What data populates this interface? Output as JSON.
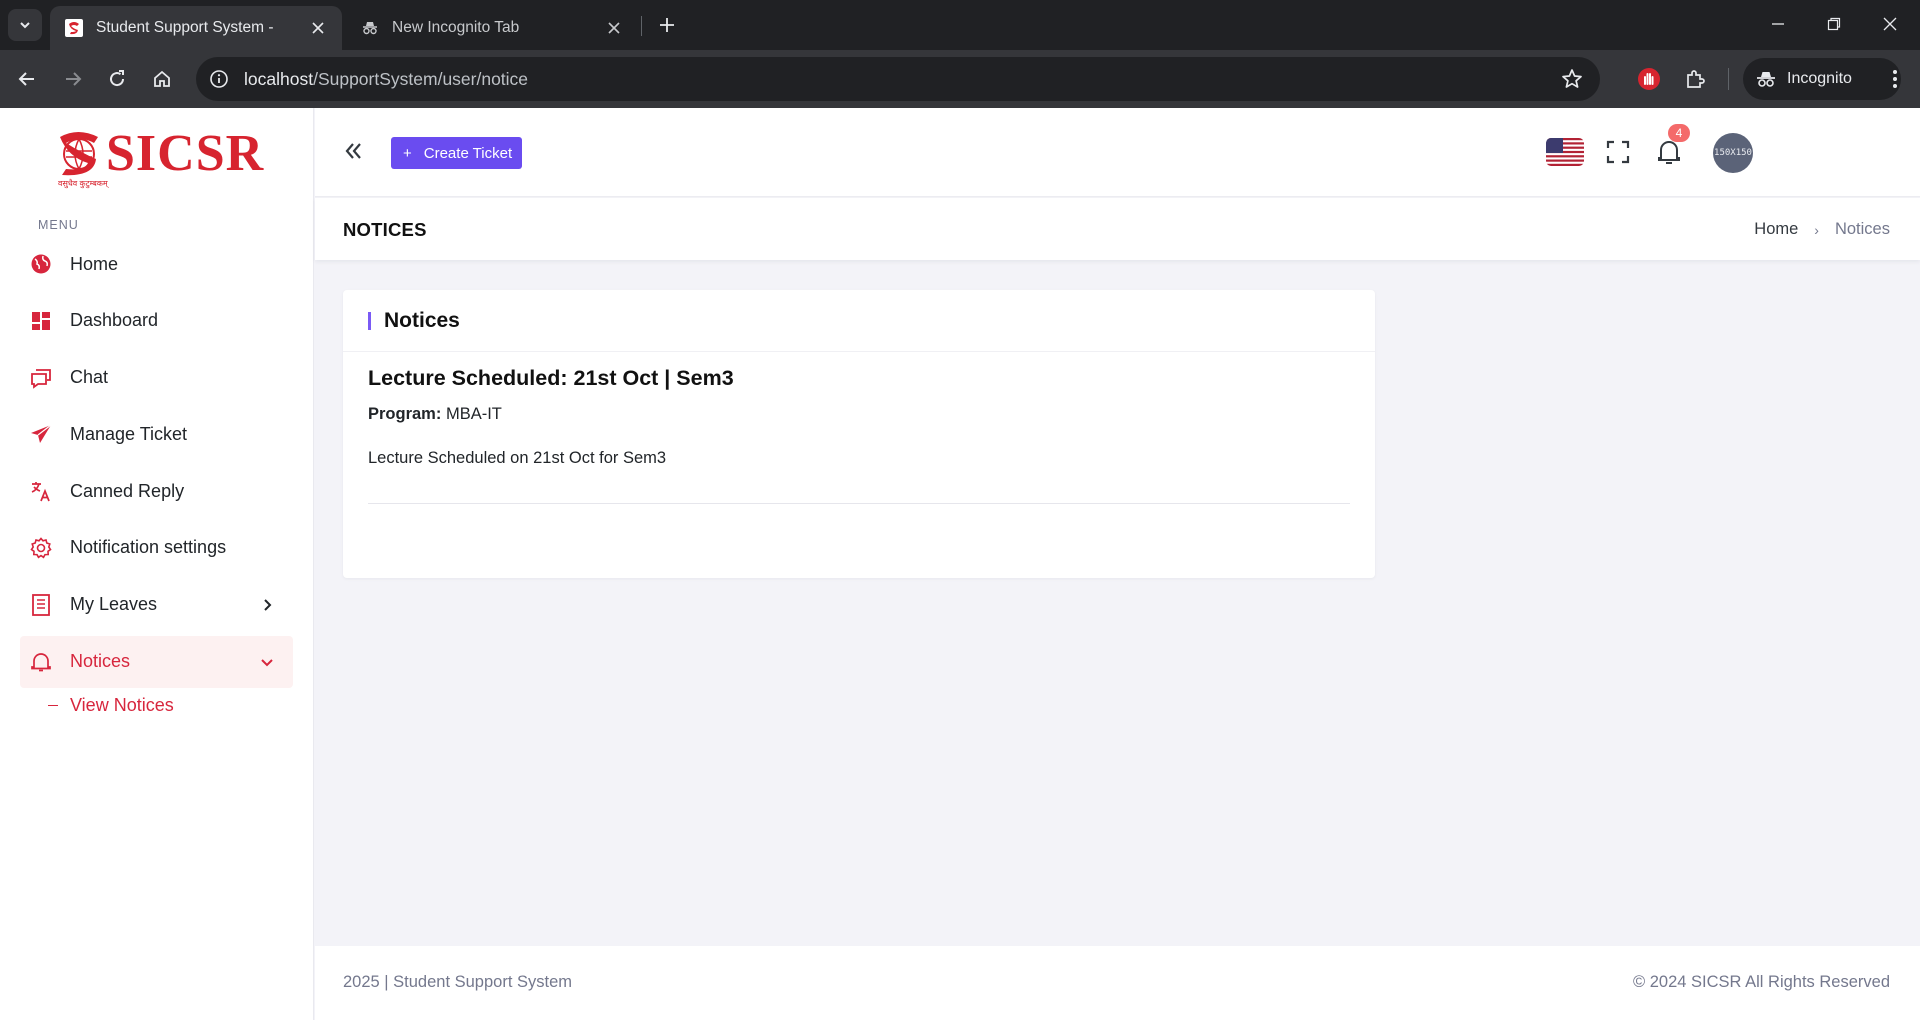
{
  "browser": {
    "tabs": [
      {
        "title": "Student Support System -",
        "active": true
      },
      {
        "title": "New Incognito Tab",
        "active": false
      }
    ],
    "url_host": "localhost",
    "url_path": "/SupportSystem/user/notice",
    "profile_label": "Incognito"
  },
  "brand": {
    "logo_text": "SICSR",
    "logo_tagline": "वसुधैव कुटुम्बकम्",
    "color": "#d7242f"
  },
  "sidebar": {
    "menu_title": "MENU",
    "items": [
      {
        "label": "Home",
        "icon": "globe-icon"
      },
      {
        "label": "Dashboard",
        "icon": "dashboard-grid-icon"
      },
      {
        "label": "Chat",
        "icon": "chat-icon"
      },
      {
        "label": "Manage Ticket",
        "icon": "send-icon"
      },
      {
        "label": "Canned Reply",
        "icon": "translate-icon"
      },
      {
        "label": "Notification settings",
        "icon": "gear-icon"
      },
      {
        "label": "My Leaves",
        "icon": "document-icon"
      },
      {
        "label": "Notices",
        "icon": "bell-icon",
        "active": true
      }
    ],
    "submenu": {
      "label": "View Notices"
    }
  },
  "topbar": {
    "create_ticket_label": "Create Ticket",
    "notification_count": "4",
    "avatar_placeholder": "150X150",
    "accent": "#6a4cf0"
  },
  "page": {
    "title": "NOTICES",
    "breadcrumb": {
      "home": "Home",
      "current": "Notices"
    }
  },
  "card": {
    "header": "Notices",
    "notice": {
      "title": "Lecture Scheduled: 21st Oct | Sem3",
      "program_label": "Program:",
      "program_value": "MBA-IT",
      "description": "Lecture Scheduled on 21st Oct for Sem3"
    }
  },
  "footer": {
    "left": "2025 | Student Support System",
    "right": "© 2024 SICSR All Rights Reserved"
  }
}
